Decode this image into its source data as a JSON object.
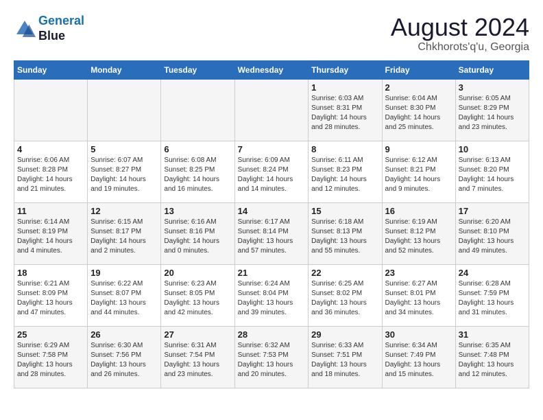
{
  "header": {
    "logo": {
      "line1": "General",
      "line2": "Blue"
    },
    "title": "August 2024",
    "location": "Chkhorots'q'u, Georgia"
  },
  "days_of_week": [
    "Sunday",
    "Monday",
    "Tuesday",
    "Wednesday",
    "Thursday",
    "Friday",
    "Saturday"
  ],
  "weeks": [
    {
      "days": [
        {
          "number": "",
          "info": ""
        },
        {
          "number": "",
          "info": ""
        },
        {
          "number": "",
          "info": ""
        },
        {
          "number": "",
          "info": ""
        },
        {
          "number": "1",
          "info": "Sunrise: 6:03 AM\nSunset: 8:31 PM\nDaylight: 14 hours and 28 minutes."
        },
        {
          "number": "2",
          "info": "Sunrise: 6:04 AM\nSunset: 8:30 PM\nDaylight: 14 hours and 25 minutes."
        },
        {
          "number": "3",
          "info": "Sunrise: 6:05 AM\nSunset: 8:29 PM\nDaylight: 14 hours and 23 minutes."
        }
      ]
    },
    {
      "days": [
        {
          "number": "4",
          "info": "Sunrise: 6:06 AM\nSunset: 8:28 PM\nDaylight: 14 hours and 21 minutes."
        },
        {
          "number": "5",
          "info": "Sunrise: 6:07 AM\nSunset: 8:27 PM\nDaylight: 14 hours and 19 minutes."
        },
        {
          "number": "6",
          "info": "Sunrise: 6:08 AM\nSunset: 8:25 PM\nDaylight: 14 hours and 16 minutes."
        },
        {
          "number": "7",
          "info": "Sunrise: 6:09 AM\nSunset: 8:24 PM\nDaylight: 14 hours and 14 minutes."
        },
        {
          "number": "8",
          "info": "Sunrise: 6:11 AM\nSunset: 8:23 PM\nDaylight: 14 hours and 12 minutes."
        },
        {
          "number": "9",
          "info": "Sunrise: 6:12 AM\nSunset: 8:21 PM\nDaylight: 14 hours and 9 minutes."
        },
        {
          "number": "10",
          "info": "Sunrise: 6:13 AM\nSunset: 8:20 PM\nDaylight: 14 hours and 7 minutes."
        }
      ]
    },
    {
      "days": [
        {
          "number": "11",
          "info": "Sunrise: 6:14 AM\nSunset: 8:19 PM\nDaylight: 14 hours and 4 minutes."
        },
        {
          "number": "12",
          "info": "Sunrise: 6:15 AM\nSunset: 8:17 PM\nDaylight: 14 hours and 2 minutes."
        },
        {
          "number": "13",
          "info": "Sunrise: 6:16 AM\nSunset: 8:16 PM\nDaylight: 14 hours and 0 minutes."
        },
        {
          "number": "14",
          "info": "Sunrise: 6:17 AM\nSunset: 8:14 PM\nDaylight: 13 hours and 57 minutes."
        },
        {
          "number": "15",
          "info": "Sunrise: 6:18 AM\nSunset: 8:13 PM\nDaylight: 13 hours and 55 minutes."
        },
        {
          "number": "16",
          "info": "Sunrise: 6:19 AM\nSunset: 8:12 PM\nDaylight: 13 hours and 52 minutes."
        },
        {
          "number": "17",
          "info": "Sunrise: 6:20 AM\nSunset: 8:10 PM\nDaylight: 13 hours and 49 minutes."
        }
      ]
    },
    {
      "days": [
        {
          "number": "18",
          "info": "Sunrise: 6:21 AM\nSunset: 8:09 PM\nDaylight: 13 hours and 47 minutes."
        },
        {
          "number": "19",
          "info": "Sunrise: 6:22 AM\nSunset: 8:07 PM\nDaylight: 13 hours and 44 minutes."
        },
        {
          "number": "20",
          "info": "Sunrise: 6:23 AM\nSunset: 8:05 PM\nDaylight: 13 hours and 42 minutes."
        },
        {
          "number": "21",
          "info": "Sunrise: 6:24 AM\nSunset: 8:04 PM\nDaylight: 13 hours and 39 minutes."
        },
        {
          "number": "22",
          "info": "Sunrise: 6:25 AM\nSunset: 8:02 PM\nDaylight: 13 hours and 36 minutes."
        },
        {
          "number": "23",
          "info": "Sunrise: 6:27 AM\nSunset: 8:01 PM\nDaylight: 13 hours and 34 minutes."
        },
        {
          "number": "24",
          "info": "Sunrise: 6:28 AM\nSunset: 7:59 PM\nDaylight: 13 hours and 31 minutes."
        }
      ]
    },
    {
      "days": [
        {
          "number": "25",
          "info": "Sunrise: 6:29 AM\nSunset: 7:58 PM\nDaylight: 13 hours and 28 minutes."
        },
        {
          "number": "26",
          "info": "Sunrise: 6:30 AM\nSunset: 7:56 PM\nDaylight: 13 hours and 26 minutes."
        },
        {
          "number": "27",
          "info": "Sunrise: 6:31 AM\nSunset: 7:54 PM\nDaylight: 13 hours and 23 minutes."
        },
        {
          "number": "28",
          "info": "Sunrise: 6:32 AM\nSunset: 7:53 PM\nDaylight: 13 hours and 20 minutes."
        },
        {
          "number": "29",
          "info": "Sunrise: 6:33 AM\nSunset: 7:51 PM\nDaylight: 13 hours and 18 minutes."
        },
        {
          "number": "30",
          "info": "Sunrise: 6:34 AM\nSunset: 7:49 PM\nDaylight: 13 hours and 15 minutes."
        },
        {
          "number": "31",
          "info": "Sunrise: 6:35 AM\nSunset: 7:48 PM\nDaylight: 13 hours and 12 minutes."
        }
      ]
    }
  ]
}
